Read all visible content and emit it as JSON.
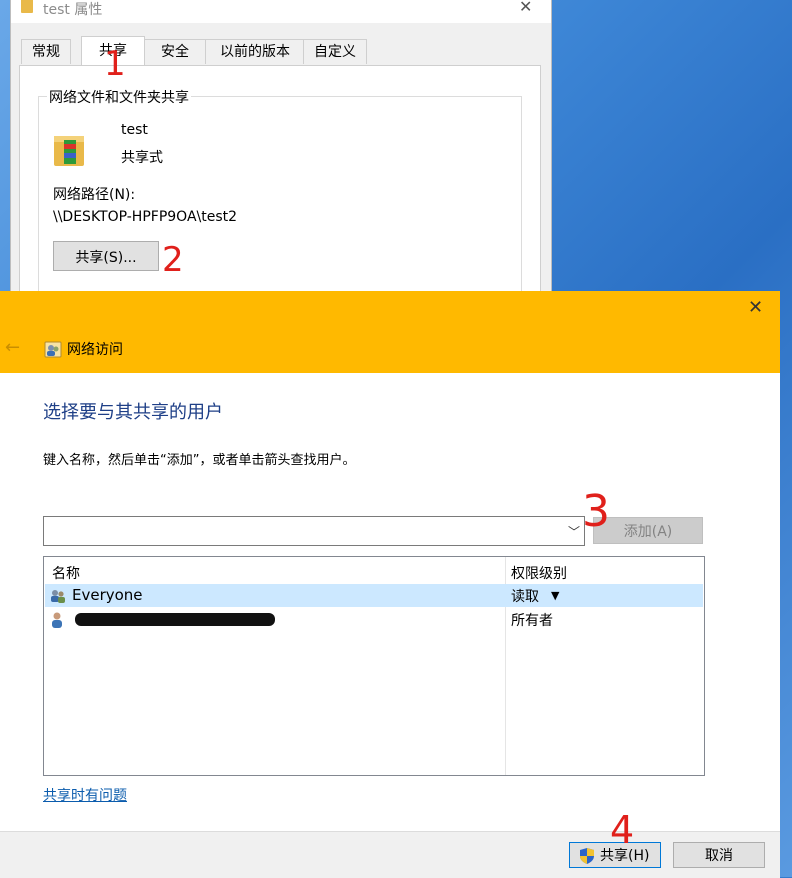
{
  "properties_window": {
    "title": "test 属性",
    "tabs": [
      {
        "label": "常规",
        "active": false
      },
      {
        "label": "共享",
        "active": true
      },
      {
        "label": "安全",
        "active": false
      },
      {
        "label": "以前的版本",
        "active": false
      },
      {
        "label": "自定义",
        "active": false
      }
    ],
    "group_title": "网络文件和文件夹共享",
    "folder_name": "test",
    "share_status": "共享式",
    "network_path_label": "网络路径(N):",
    "network_path": "\\\\DESKTOP-HPFP9OA\\test2",
    "share_button_label": "共享(S)..."
  },
  "dialog": {
    "title": "网络访问",
    "heading": "选择要与其共享的用户",
    "instruction": "键入名称，然后单击“添加”，或者单击箭头查找用户。",
    "name_input": {
      "value": "",
      "placeholder": ""
    },
    "add_button_label": "添加(A)",
    "columns": {
      "name": "名称",
      "permission": "权限级别"
    },
    "users": [
      {
        "name": "Everyone",
        "permission": "读取",
        "selected": true
      },
      {
        "name": "",
        "permission": "所有者",
        "selected": false
      }
    ],
    "trouble_link": "共享时有问题",
    "share_button_label": "共享(H)",
    "cancel_button_label": "取消",
    "header_color": "#ffb900"
  },
  "annotations": [
    "1",
    "2",
    "3",
    "4"
  ]
}
